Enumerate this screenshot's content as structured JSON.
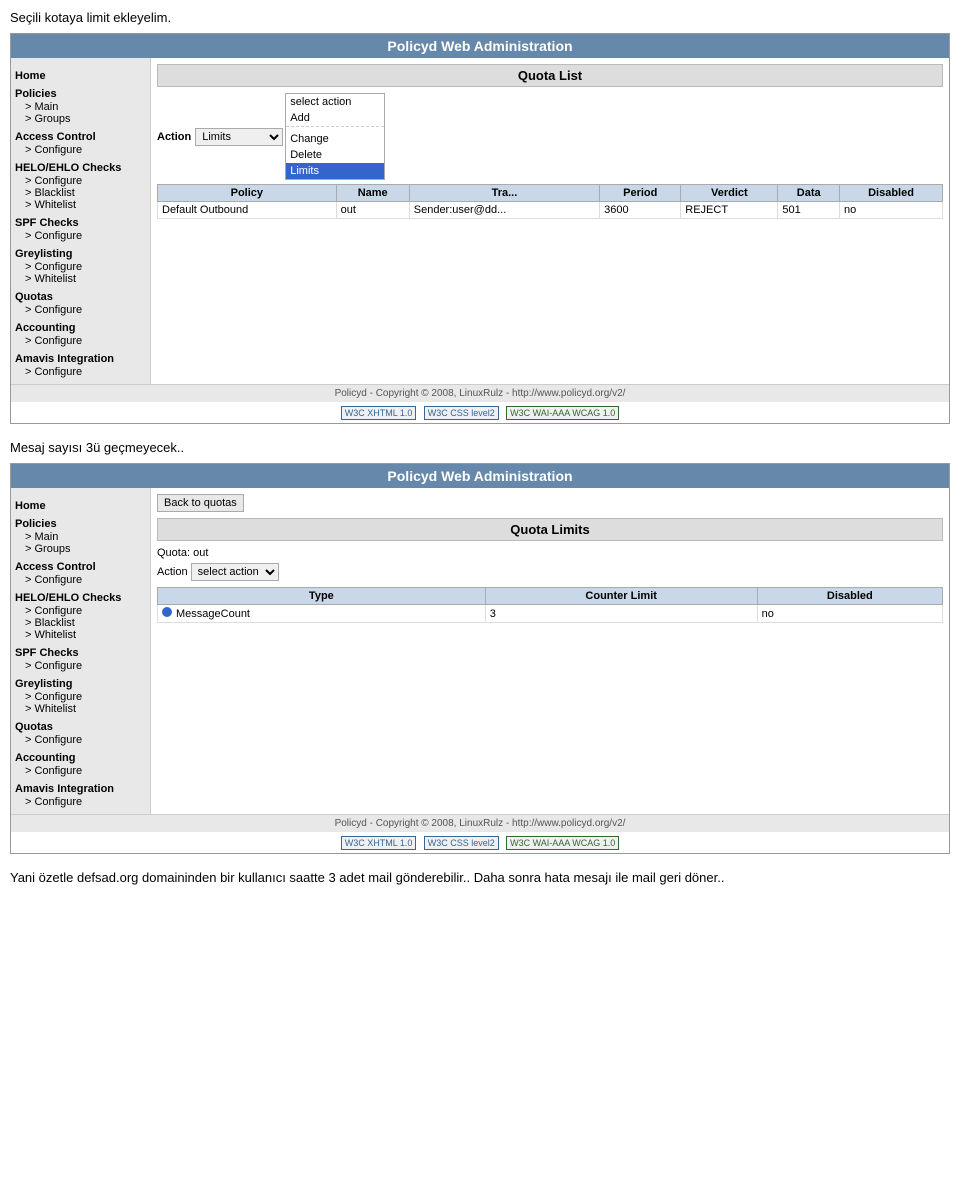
{
  "intro_text": "Seçili kotaya limit ekleyelim.",
  "panel1": {
    "header": "Policyd Web Administration",
    "section_title": "Quota List",
    "action_label": "Action",
    "action_placeholder": "select action",
    "dropdown": {
      "items": [
        "select action",
        "Add",
        "Change",
        "Delete",
        "Limits"
      ],
      "selected": "Limits"
    },
    "table": {
      "columns": [
        "Policy",
        "Name",
        "Tra...",
        "Period",
        "Verdict",
        "Data",
        "Disabled"
      ],
      "rows": [
        [
          "Default Outbound",
          "out",
          "Sender:user@dd...",
          "3600",
          "REJECT",
          "501",
          "no"
        ]
      ]
    },
    "footer": "Policyd - Copyright © 2008, LinuxRulz - http://www.policyd.org/v2/"
  },
  "panel2": {
    "header": "Policyd Web Administration",
    "back_button": "Back to quotas",
    "section_title": "Quota Limits",
    "quota_info": "Quota: out",
    "action_label": "Action",
    "action_placeholder": "select action",
    "table": {
      "columns": [
        "Type",
        "Counter Limit",
        "Disabled"
      ],
      "rows": [
        [
          "MessageCount",
          "3",
          "no"
        ]
      ]
    },
    "footer": "Policyd - Copyright © 2008, LinuxRulz - http://www.policyd.org/v2/"
  },
  "sidebar1": {
    "home": "Home",
    "menu": [
      {
        "label": "Policies",
        "children": [
          "Main",
          "Groups"
        ]
      },
      {
        "label": "Access Control",
        "children": [
          "Configure"
        ]
      },
      {
        "label": "HELO/EHLO Checks",
        "children": [
          "Configure",
          "Blacklist",
          "Whitelist"
        ]
      },
      {
        "label": "SPF Checks",
        "children": [
          "Configure"
        ]
      },
      {
        "label": "Greylisting",
        "children": [
          "Configure",
          "Whitelist"
        ]
      },
      {
        "label": "Quotas",
        "children": [
          "Configure"
        ]
      },
      {
        "label": "Accounting",
        "children": [
          "Configure"
        ]
      },
      {
        "label": "Amavis Integration",
        "children": [
          "Configure"
        ]
      }
    ]
  },
  "outro_text1": "Mesaj sayısı 3ü geçmeyecek..",
  "outro_text2": "Yani özetle defsad.org domaininden bir kullanıcı saatte 3 adet mail gönderebilir.. Daha sonra hata mesajı ile mail geri döner.."
}
